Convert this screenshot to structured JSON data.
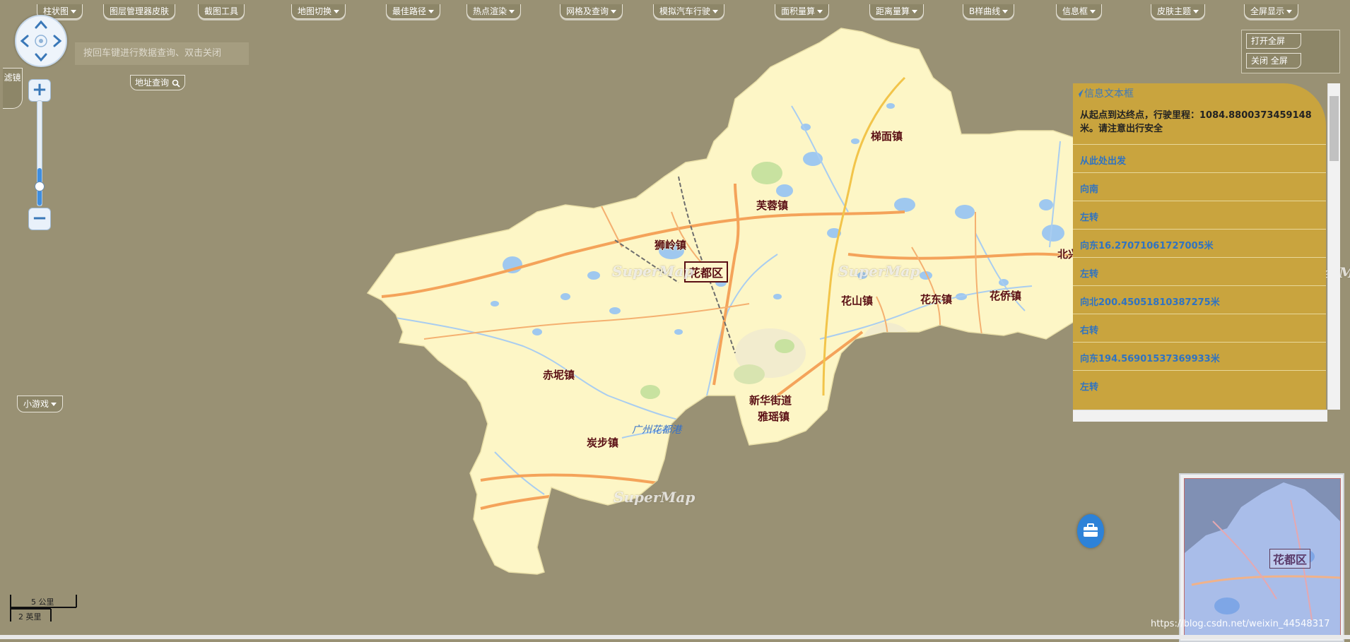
{
  "toolbar": {
    "items": [
      {
        "label": "柱状图"
      },
      {
        "label": "图层管理器皮肤"
      },
      {
        "label": "截图工具"
      },
      {
        "label": "地图切换"
      },
      {
        "label": "最佳路径"
      },
      {
        "label": "热点渲染"
      },
      {
        "label": "网格及查询"
      },
      {
        "label": "模拟汽车行驶"
      },
      {
        "label": "面积量算"
      },
      {
        "label": "距离量算"
      },
      {
        "label": "B样曲线"
      },
      {
        "label": "信息框"
      },
      {
        "label": "皮肤主题"
      },
      {
        "label": "全屏显示"
      }
    ]
  },
  "fullscreen_menu": {
    "open": "打开全屏",
    "close": "关闭 全屏"
  },
  "search": {
    "hint": "按回车键进行数据查询、双击关闭",
    "address_button": "地址查询"
  },
  "filter_tab": "滤镜",
  "game_button": "小游戏",
  "map": {
    "district_label": "花都区",
    "places": [
      "梯面镇",
      "芙蓉镇",
      "狮岭镇",
      "花山镇",
      "花东镇",
      "花侨镇",
      "北兴镇",
      "赤坭镇",
      "新华街道",
      "雅瑶镇",
      "炭步镇"
    ],
    "river_label": "广州花都港",
    "watermark": "SuperMap",
    "colors": {
      "background": "#999174",
      "land": "#fdf6c6",
      "water": "#9fc8ef",
      "road": "#f4a35a",
      "green": "#c8e2a0"
    }
  },
  "info_panel": {
    "title": "信息文本框",
    "message": "从起点到达终点，行驶里程：1084.8800373459148米。请注意出行安全",
    "steps": [
      "从此处出发",
      "向南",
      "左转",
      "向东16.27071061727005米",
      "左转",
      "向北200.45051810387275米",
      "右转",
      "向东194.56901537369933米",
      "左转"
    ]
  },
  "overview": {
    "label": "花都区"
  },
  "scale_bar": {
    "metric": "5 公里",
    "imperial": "2 英里"
  },
  "credit": "https://blog.csdn.net/weixin_44548317"
}
